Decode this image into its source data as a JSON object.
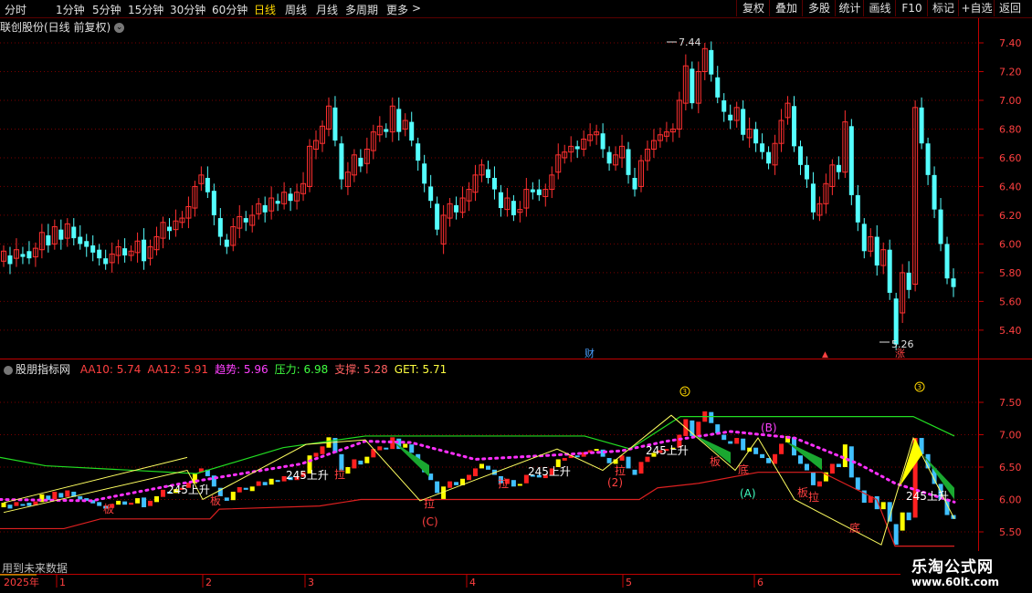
{
  "toolbar": {
    "periods": [
      "分时",
      "1分钟",
      "5分钟",
      "15分钟",
      "30分钟",
      "60分钟",
      "日线",
      "周线",
      "月线",
      "多周期",
      "更多"
    ],
    "active_period": "日线",
    "more_arrow": ">",
    "right_buttons": [
      "复权",
      "叠加",
      "多股",
      "统计",
      "画线",
      "F10",
      "标记",
      "+自选",
      "返回"
    ]
  },
  "main": {
    "stock_title": "联创股份(日线 前复权)",
    "title_dropdown_icon": "chevron-down-icon",
    "high_label": "7.44",
    "low_label": "5.26",
    "marker_cai": "财",
    "marker_zhang": "涨"
  },
  "indicator": {
    "name": "股朋指标网",
    "values": [
      {
        "label": "AA10: 5.74",
        "color": "#ff4040"
      },
      {
        "label": "AA12: 5.91",
        "color": "#ff4040"
      },
      {
        "label": "趋势: 5.96",
        "color": "#ff40ff"
      },
      {
        "label": "压力: 6.98",
        "color": "#40ff40"
      },
      {
        "label": "支撑: 5.28",
        "color": "#ff6060"
      },
      {
        "label": "GET: 5.71",
        "color": "#ffff40"
      }
    ],
    "future_note": "用到未来数据",
    "annotations": {
      "rise_245": "245上升",
      "la": "拉",
      "ban": "板",
      "di": "底",
      "wave_A": "(A)",
      "wave_B": "(B)",
      "wave_C": "(C)",
      "num_3": "3",
      "num_2": "(2)"
    }
  },
  "axes": {
    "price_ticks": [
      "7.40",
      "7.20",
      "7.00",
      "6.80",
      "6.60",
      "6.40",
      "6.20",
      "6.00",
      "5.80",
      "5.60",
      "5.40"
    ],
    "ind_ticks": [
      "7.50",
      "7.00",
      "6.50",
      "6.00",
      "5.50"
    ],
    "date_year": "2025年",
    "months": [
      "1",
      "2",
      "3",
      "4",
      "5",
      "6"
    ]
  },
  "watermark": {
    "line1": "乐淘公式网",
    "line2": "www.60lt.com"
  },
  "colors": {
    "up": "#ff3030",
    "down": "#54ffff",
    "grid": "#7a0000",
    "axis": "#c00000",
    "pressure": "#22dd22",
    "support": "#dd2020",
    "trend": "#ff30ff",
    "accent": "#ffd700"
  },
  "chart_data": {
    "type": "candlestick",
    "ylim": [
      5.3,
      7.5
    ],
    "candles": [
      [
        5.88,
        5.95
      ],
      [
        5.92,
        5.86
      ],
      [
        5.9,
        5.96
      ],
      [
        5.93,
        5.91
      ],
      [
        5.95,
        5.9
      ],
      [
        5.91,
        5.97
      ],
      [
        5.96,
        6.08
      ],
      [
        6.06,
        5.99
      ],
      [
        6.0,
        6.12
      ],
      [
        6.1,
        6.03
      ],
      [
        6.04,
        6.14
      ],
      [
        6.12,
        6.04
      ],
      [
        6.05,
        6.0
      ],
      [
        6.02,
        5.98
      ],
      [
        5.99,
        5.94
      ],
      [
        5.96,
        5.9
      ],
      [
        5.9,
        5.86
      ],
      [
        5.87,
        5.93
      ],
      [
        5.92,
        5.98
      ],
      [
        5.97,
        5.92
      ],
      [
        5.92,
        5.95
      ],
      [
        5.94,
        6.02
      ],
      [
        6.03,
        5.88
      ],
      [
        5.9,
        5.98
      ],
      [
        5.96,
        6.05
      ],
      [
        6.04,
        6.15
      ],
      [
        6.12,
        6.09
      ],
      [
        6.1,
        6.16
      ],
      [
        6.15,
        6.18
      ],
      [
        6.18,
        6.26
      ],
      [
        6.25,
        6.4
      ],
      [
        6.42,
        6.48
      ],
      [
        6.46,
        6.36
      ],
      [
        6.37,
        6.2
      ],
      [
        6.18,
        6.05
      ],
      [
        6.03,
        5.98
      ],
      [
        5.99,
        6.12
      ],
      [
        6.11,
        6.19
      ],
      [
        6.18,
        6.15
      ],
      [
        6.13,
        6.2
      ],
      [
        6.21,
        6.28
      ],
      [
        6.27,
        6.22
      ],
      [
        6.23,
        6.32
      ],
      [
        6.3,
        6.28
      ],
      [
        6.28,
        6.36
      ],
      [
        6.35,
        6.3
      ],
      [
        6.3,
        6.36
      ],
      [
        6.35,
        6.42
      ],
      [
        6.4,
        6.68
      ],
      [
        6.66,
        6.72
      ],
      [
        6.7,
        6.82
      ],
      [
        6.8,
        6.96
      ],
      [
        6.95,
        6.72
      ],
      [
        6.7,
        6.45
      ],
      [
        6.4,
        6.5
      ],
      [
        6.48,
        6.62
      ],
      [
        6.6,
        6.54
      ],
      [
        6.56,
        6.66
      ],
      [
        6.65,
        6.78
      ],
      [
        6.76,
        6.82
      ],
      [
        6.8,
        6.78
      ],
      [
        6.78,
        6.96
      ],
      [
        6.94,
        6.78
      ],
      [
        6.8,
        6.86
      ],
      [
        6.85,
        6.72
      ],
      [
        6.7,
        6.58
      ],
      [
        6.56,
        6.42
      ],
      [
        6.4,
        6.3
      ],
      [
        6.28,
        6.1
      ],
      [
        6.0,
        6.2
      ],
      [
        6.18,
        6.28
      ],
      [
        6.27,
        6.22
      ],
      [
        6.22,
        6.32
      ],
      [
        6.3,
        6.38
      ],
      [
        6.36,
        6.48
      ],
      [
        6.48,
        6.55
      ],
      [
        6.52,
        6.46
      ],
      [
        6.46,
        6.38
      ],
      [
        6.36,
        6.25
      ],
      [
        6.24,
        6.32
      ],
      [
        6.3,
        6.2
      ],
      [
        6.22,
        6.24
      ],
      [
        6.25,
        6.38
      ],
      [
        6.38,
        6.36
      ],
      [
        6.38,
        6.34
      ],
      [
        6.33,
        6.38
      ],
      [
        6.38,
        6.48
      ],
      [
        6.5,
        6.62
      ],
      [
        6.6,
        6.64
      ],
      [
        6.64,
        6.68
      ],
      [
        6.68,
        6.66
      ],
      [
        6.66,
        6.73
      ],
      [
        6.72,
        6.76
      ],
      [
        6.76,
        6.78
      ],
      [
        6.77,
        6.66
      ],
      [
        6.64,
        6.56
      ],
      [
        6.55,
        6.62
      ],
      [
        6.6,
        6.68
      ],
      [
        6.66,
        6.48
      ],
      [
        6.46,
        6.38
      ],
      [
        6.4,
        6.58
      ],
      [
        6.58,
        6.66
      ],
      [
        6.66,
        6.72
      ],
      [
        6.72,
        6.76
      ],
      [
        6.75,
        6.78
      ],
      [
        6.78,
        6.8
      ],
      [
        6.8,
        7.0
      ],
      [
        6.98,
        7.24
      ],
      [
        7.22,
        6.98
      ],
      [
        6.98,
        7.2
      ],
      [
        7.2,
        7.36
      ],
      [
        7.35,
        7.18
      ],
      [
        7.16,
        7.02
      ],
      [
        7.0,
        6.92
      ],
      [
        6.9,
        6.86
      ],
      [
        6.86,
        6.95
      ],
      [
        6.94,
        6.76
      ],
      [
        6.74,
        6.8
      ],
      [
        6.8,
        6.7
      ],
      [
        6.7,
        6.64
      ],
      [
        6.64,
        6.56
      ],
      [
        6.55,
        6.7
      ],
      [
        6.7,
        6.86
      ],
      [
        6.88,
        6.98
      ],
      [
        6.96,
        6.68
      ],
      [
        6.68,
        6.55
      ],
      [
        6.55,
        6.45
      ],
      [
        6.42,
        6.22
      ],
      [
        6.2,
        6.28
      ],
      [
        6.28,
        6.42
      ],
      [
        6.4,
        6.55
      ],
      [
        6.55,
        6.5
      ],
      [
        6.5,
        6.85
      ],
      [
        6.82,
        6.34
      ],
      [
        6.34,
        6.15
      ],
      [
        6.14,
        5.95
      ],
      [
        5.95,
        6.05
      ],
      [
        6.05,
        5.85
      ],
      [
        5.85,
        5.96
      ],
      [
        5.96,
        5.66
      ],
      [
        5.62,
        5.3
      ],
      [
        5.52,
        5.8
      ],
      [
        5.8,
        5.68
      ],
      [
        5.72,
        6.95
      ],
      [
        6.95,
        6.7
      ],
      [
        6.7,
        6.48
      ],
      [
        6.48,
        6.24
      ],
      [
        6.24,
        6.0
      ],
      [
        6.0,
        5.76
      ],
      [
        5.76,
        5.7
      ]
    ],
    "wicks": [
      [
        5.84,
        6.0
      ],
      [
        6.1,
        6.22
      ],
      [
        6.35,
        6.62
      ],
      [
        6.7,
        7.05
      ],
      [
        7.05,
        7.44
      ],
      [
        5.26,
        7.44
      ]
    ]
  }
}
